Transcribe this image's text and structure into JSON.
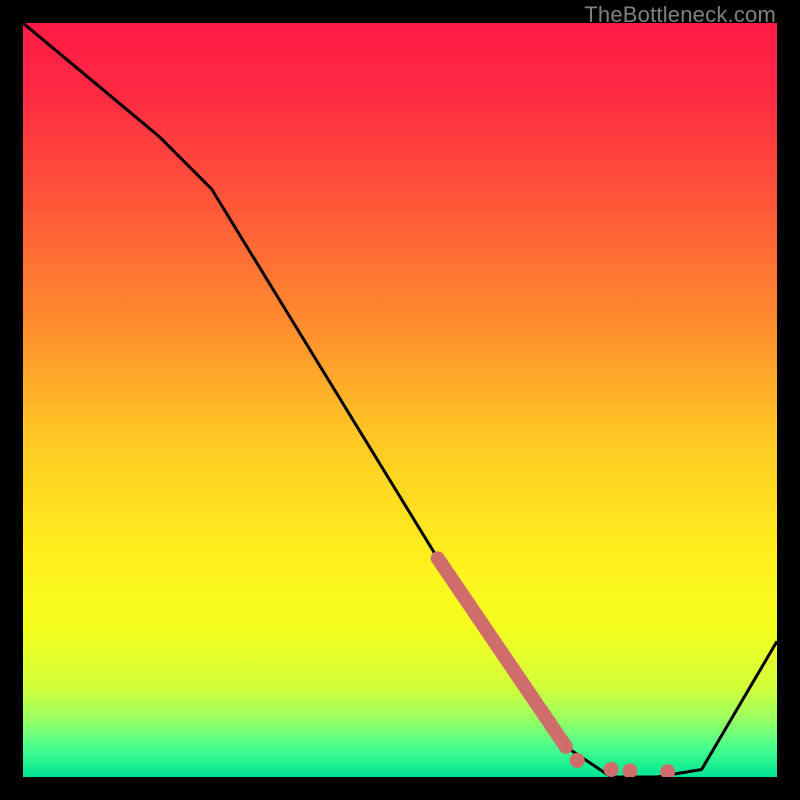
{
  "watermark": "TheBottleneck.com",
  "colors": {
    "frame": "#000000",
    "line": "#000000",
    "marker": "#cf6d6d"
  },
  "chart_data": {
    "type": "line",
    "title": "",
    "xlabel": "",
    "ylabel": "",
    "xlim": [
      0,
      100
    ],
    "ylim": [
      0,
      100
    ],
    "grid": false,
    "legend": false,
    "series": [
      {
        "name": "bottleneck-curve",
        "x": [
          0,
          18,
          25,
          55,
          72,
          78,
          84,
          90,
          100
        ],
        "y": [
          100,
          85,
          78,
          29,
          4,
          0,
          0,
          1,
          18
        ]
      }
    ],
    "markers": [
      {
        "name": "highlight-segment",
        "shape": "thick-line",
        "x": [
          55,
          72
        ],
        "y": [
          29,
          4
        ]
      },
      {
        "name": "dot-1",
        "shape": "circle",
        "x": 73.5,
        "y": 2.2
      },
      {
        "name": "dot-2",
        "shape": "circle",
        "x": 78.0,
        "y": 1.0
      },
      {
        "name": "dot-3",
        "shape": "circle",
        "x": 80.5,
        "y": 0.8
      },
      {
        "name": "dot-4",
        "shape": "circle",
        "x": 85.5,
        "y": 0.7
      }
    ],
    "gradient_stops": [
      {
        "offset": 0.0,
        "color": "#ff1a46"
      },
      {
        "offset": 0.1,
        "color": "#ff2b42"
      },
      {
        "offset": 0.25,
        "color": "#ff5a38"
      },
      {
        "offset": 0.4,
        "color": "#ff8d2e"
      },
      {
        "offset": 0.55,
        "color": "#ffc824"
      },
      {
        "offset": 0.7,
        "color": "#ffee1e"
      },
      {
        "offset": 0.8,
        "color": "#f6ff1e"
      },
      {
        "offset": 0.88,
        "color": "#d3ff3a"
      },
      {
        "offset": 0.92,
        "color": "#9fff5f"
      },
      {
        "offset": 0.96,
        "color": "#4aff8d"
      },
      {
        "offset": 1.0,
        "color": "#00e694"
      }
    ]
  }
}
